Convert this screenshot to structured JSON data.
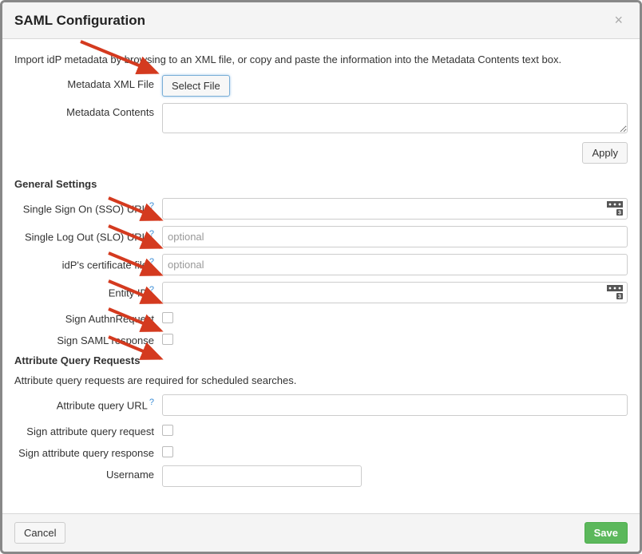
{
  "header": {
    "title": "SAML Configuration"
  },
  "intro": "Import idP metadata by browsing to an XML file, or copy and paste the information into the Metadata Contents text box.",
  "metadata": {
    "xml_label": "Metadata XML File",
    "select_file": "Select File",
    "contents_label": "Metadata Contents",
    "contents_value": ""
  },
  "apply": "Apply",
  "general": {
    "heading": "General Settings",
    "sso_label": "Single Sign On (SSO) URL",
    "sso_value": "",
    "slo_label": "Single Log Out (SLO) URL",
    "slo_placeholder": "optional",
    "idp_cert_label": "idP's certificate file",
    "idp_cert_placeholder": "optional",
    "entity_label": "Entity ID",
    "entity_value": "",
    "sign_authn_label": "Sign AuthnRequest",
    "sign_saml_label": "Sign SAML response"
  },
  "attr": {
    "heading": "Attribute Query Requests",
    "hint": "Attribute query requests are required for scheduled searches.",
    "url_label": "Attribute query URL",
    "url_value": "",
    "sign_req_label": "Sign attribute query request",
    "sign_resp_label": "Sign attribute query response",
    "username_label": "Username"
  },
  "footer": {
    "cancel": "Cancel",
    "save": "Save"
  }
}
